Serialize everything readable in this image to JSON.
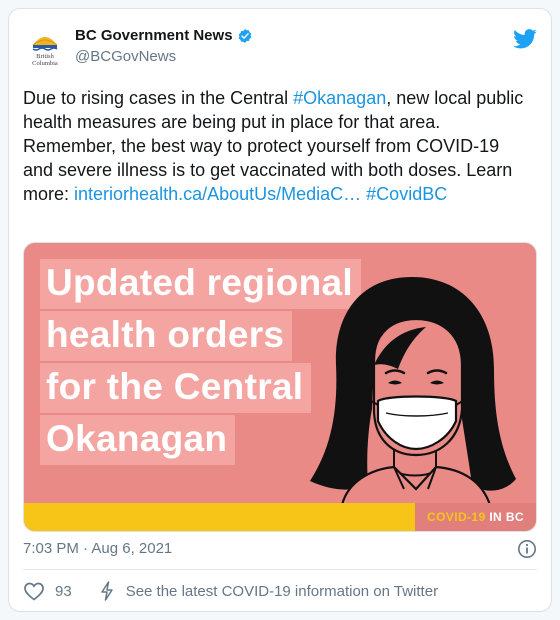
{
  "tweet": {
    "author": {
      "name": "BC Government News",
      "handle": "@BCGovNews",
      "verified": true,
      "logo_text_top": "British",
      "logo_text_bottom": "Columbia"
    },
    "text": {
      "part1": "Due to rising cases in the Central ",
      "hashtag1": "#Okanagan",
      "part2": ", new local public health measures are being put in place for that area. Remember, the best way to protect yourself from COVID-19 and severe illness is to get vaccinated with both doses. Learn more: ",
      "link": "interiorhealth.ca/AboutUs/MediaC…",
      "space": " ",
      "hashtag2": "#CovidBC"
    },
    "media": {
      "headline_lines": [
        "Updated regional",
        "health orders",
        "for the Central",
        "Okanagan"
      ],
      "badge_part1": "COVID-19",
      "badge_part2": " IN BC"
    },
    "timestamp": "7:03 PM · Aug 6, 2021",
    "likes": "93",
    "cta": "See the latest COVID-19 information on Twitter",
    "icons": {
      "platform": "twitter-bird-icon",
      "verified": "verified-badge-icon",
      "info": "info-icon",
      "like": "heart-icon",
      "cta": "lightning-icon"
    },
    "colors": {
      "link": "#1b95e0",
      "image_background": "#e98a86",
      "yellow_strip": "#f7c518"
    }
  }
}
